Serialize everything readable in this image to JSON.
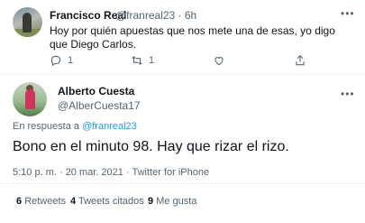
{
  "reply_tweet": {
    "name": "Francisco Real",
    "handle_time": "@franreal23 · 6h",
    "text": "Hoy por quién apuestas que nos mete una de esas, yo digo que Diego Carlos.",
    "reply_count": "1",
    "retweet_count": "1",
    "icons": [
      "reply-icon",
      "retweet-icon",
      "like-icon",
      "share-icon",
      "more-icon"
    ]
  },
  "main_tweet": {
    "name": "Alberto Cuesta",
    "handle": "@AlberCuesta17",
    "replying_prefix": "En respuesta a",
    "replying_to": "@franreal23",
    "text": "Bono en el minuto 98. Hay que rizar el rizo.",
    "meta": "5:10 p. m. · 20 mar. 2021 · Twitter for iPhone",
    "stats": {
      "retweets_count": "6",
      "retweets_label": "Retweets",
      "quotes_count": "4",
      "quotes_label": "Tweets citados",
      "likes_count": "9",
      "likes_label": "Me gusta"
    }
  },
  "colors": {
    "link": "#1d9bf0",
    "secondary_text": "#536471",
    "primary_text": "#0f1419",
    "divider": "#eff3f4"
  }
}
